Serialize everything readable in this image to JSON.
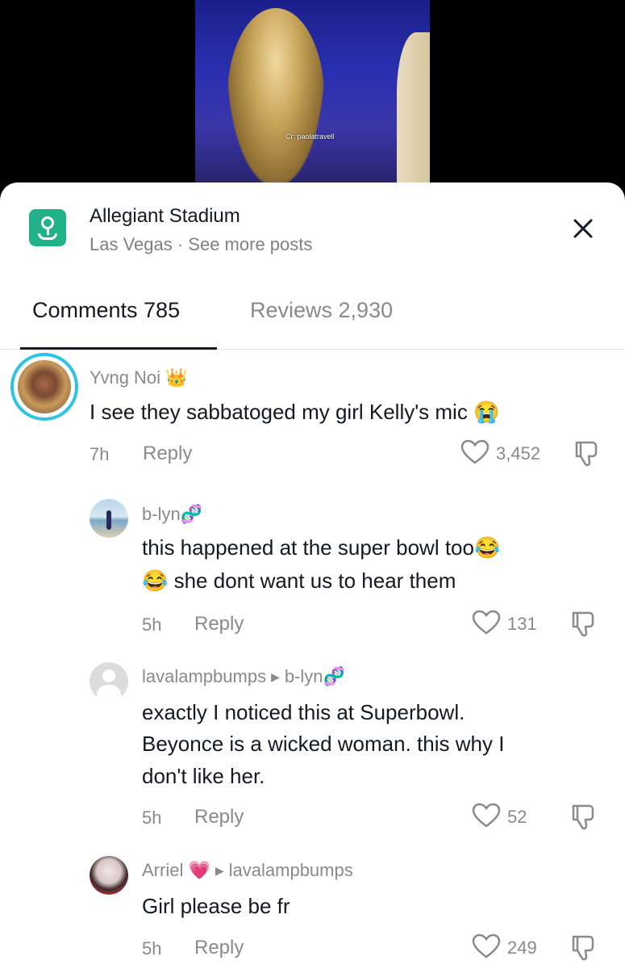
{
  "video": {
    "watermark": "Cr: paolatravell"
  },
  "location": {
    "title": "Allegiant Stadium",
    "subtitle": "Las Vegas · See more posts"
  },
  "tabs": {
    "comments": "Comments 785",
    "reviews": "Reviews 2,930"
  },
  "comments": [
    {
      "user": "Yvng Noi",
      "badge": "👑",
      "text": "I see they sabbatoged my girl Kelly's mic 😭",
      "time": "7h",
      "reply": "Reply",
      "likes": "3,452"
    },
    {
      "user": "b-lyn",
      "badge": "🧬",
      "text_line1": "this happened at the super bowl too😂",
      "text_line2": "😂 she dont want us to hear them",
      "time": "5h",
      "reply": "Reply",
      "likes": "131"
    },
    {
      "user": "lavalampbumps",
      "reply_to": "b-lyn",
      "reply_to_badge": "🧬",
      "text_line1": "exactly I noticed this at Superbowl.",
      "text_line2": "Beyonce is a wicked woman. this why I",
      "text_line3": "don't like her.",
      "time": "5h",
      "reply": "Reply",
      "likes": "52"
    },
    {
      "user": "Arriel",
      "badge": "💗",
      "reply_to": "lavalampbumps",
      "text": "Girl please be fr",
      "time": "5h",
      "reply": "Reply",
      "likes": "249"
    }
  ],
  "colors": {
    "accent": "#22b28a",
    "story_ring": "#2bc3e6",
    "muted": "#8a8a8a"
  }
}
